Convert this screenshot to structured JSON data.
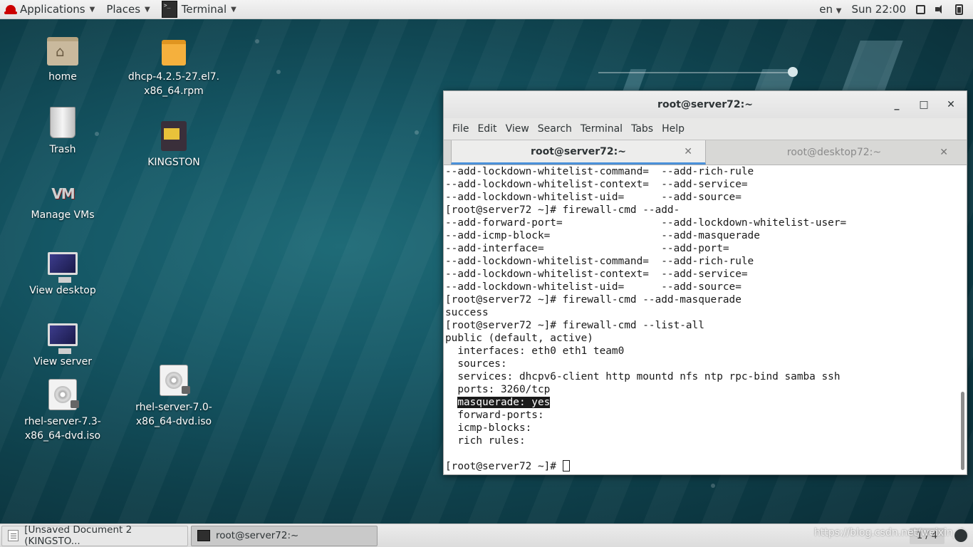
{
  "top_panel": {
    "applications_label": "Applications",
    "places_label": "Places",
    "terminal_label": "Terminal",
    "language": "en",
    "clock": "Sun 22:00"
  },
  "desktop_icons": {
    "home": "home",
    "dhcp_rpm_line1": "dhcp-4.2.5-27.el7.",
    "dhcp_rpm_line2": "x86_64.rpm",
    "trash": "Trash",
    "kingston": "KINGSTON",
    "manage_vms": "Manage VMs",
    "view_desktop": "View desktop",
    "view_server": "View server",
    "rhel73_line1": "rhel-server-7.3-",
    "rhel73_line2": "x86_64-dvd.iso",
    "rhel70_line1": "rhel-server-7.0-",
    "rhel70_line2": "x86_64-dvd.iso"
  },
  "terminal_window": {
    "title": "root@server72:~",
    "minimize": "_",
    "maximize": "□",
    "close": "✕",
    "menu": [
      "File",
      "Edit",
      "View",
      "Search",
      "Terminal",
      "Tabs",
      "Help"
    ],
    "tabs": [
      {
        "label": "root@server72:~",
        "active": true,
        "close": "✕"
      },
      {
        "label": "root@desktop72:~",
        "active": false,
        "close": "✕"
      }
    ],
    "lines": [
      "--add-lockdown-whitelist-command=  --add-rich-rule",
      "--add-lockdown-whitelist-context=  --add-service=",
      "--add-lockdown-whitelist-uid=      --add-source=",
      "[root@server72 ~]# firewall-cmd --add-",
      "--add-forward-port=                --add-lockdown-whitelist-user=",
      "--add-icmp-block=                  --add-masquerade",
      "--add-interface=                   --add-port=",
      "--add-lockdown-whitelist-command=  --add-rich-rule",
      "--add-lockdown-whitelist-context=  --add-service=",
      "--add-lockdown-whitelist-uid=      --add-source=",
      "[root@server72 ~]# firewall-cmd --add-masquerade",
      "success",
      "[root@server72 ~]# firewall-cmd --list-all",
      "public (default, active)",
      "  interfaces: eth0 eth1 team0",
      "  sources:",
      "  services: dhcpv6-client http mountd nfs ntp rpc-bind samba ssh",
      "  ports: 3260/tcp"
    ],
    "highlight_prefix": "  ",
    "highlight_line": "masquerade: yes",
    "lines_after": [
      "  forward-ports:",
      "  icmp-blocks:",
      "  rich rules:",
      " "
    ],
    "prompt": "[root@server72 ~]# "
  },
  "taskbar": {
    "items": [
      {
        "label": "[Unsaved Document 2 (KINGSTO...",
        "active": false
      },
      {
        "label": "root@server72:~",
        "active": true
      }
    ],
    "workspace": "1 / 4",
    "watermark": "https://blog.csdn.net/weixin_4"
  },
  "colors": {
    "terminal_bg": "#ffffff",
    "terminal_fg": "#1a1a1a",
    "panel_bg": "#e8e8e8",
    "tab_accent": "#4a90d9",
    "redhat": "#cc0000"
  }
}
